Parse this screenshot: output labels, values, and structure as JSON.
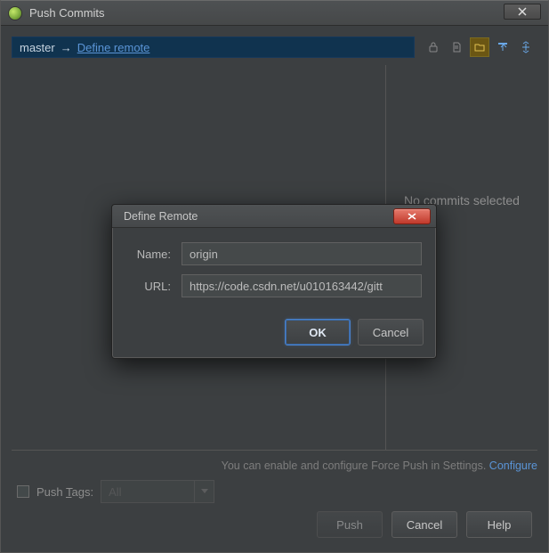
{
  "window": {
    "title": "Push Commits"
  },
  "branch": {
    "name": "master",
    "arrow": "→",
    "defineLink": "Define remote"
  },
  "rightPane": {
    "empty": "No commits selected"
  },
  "hint": {
    "text": "You can enable and configure Force Push in Settings. ",
    "link": "Configure"
  },
  "tags": {
    "label_pre": "Push ",
    "label_ul": "T",
    "label_post": "ags:",
    "comboValue": "All"
  },
  "buttons": {
    "push": "Push",
    "cancel": "Cancel",
    "help": "Help"
  },
  "modal": {
    "title": "Define Remote",
    "nameLabel": "Name:",
    "nameValue": "origin",
    "urlLabel": "URL:",
    "urlValue": "https://code.csdn.net/u010163442/gitt",
    "ok": "OK",
    "cancel": "Cancel"
  }
}
